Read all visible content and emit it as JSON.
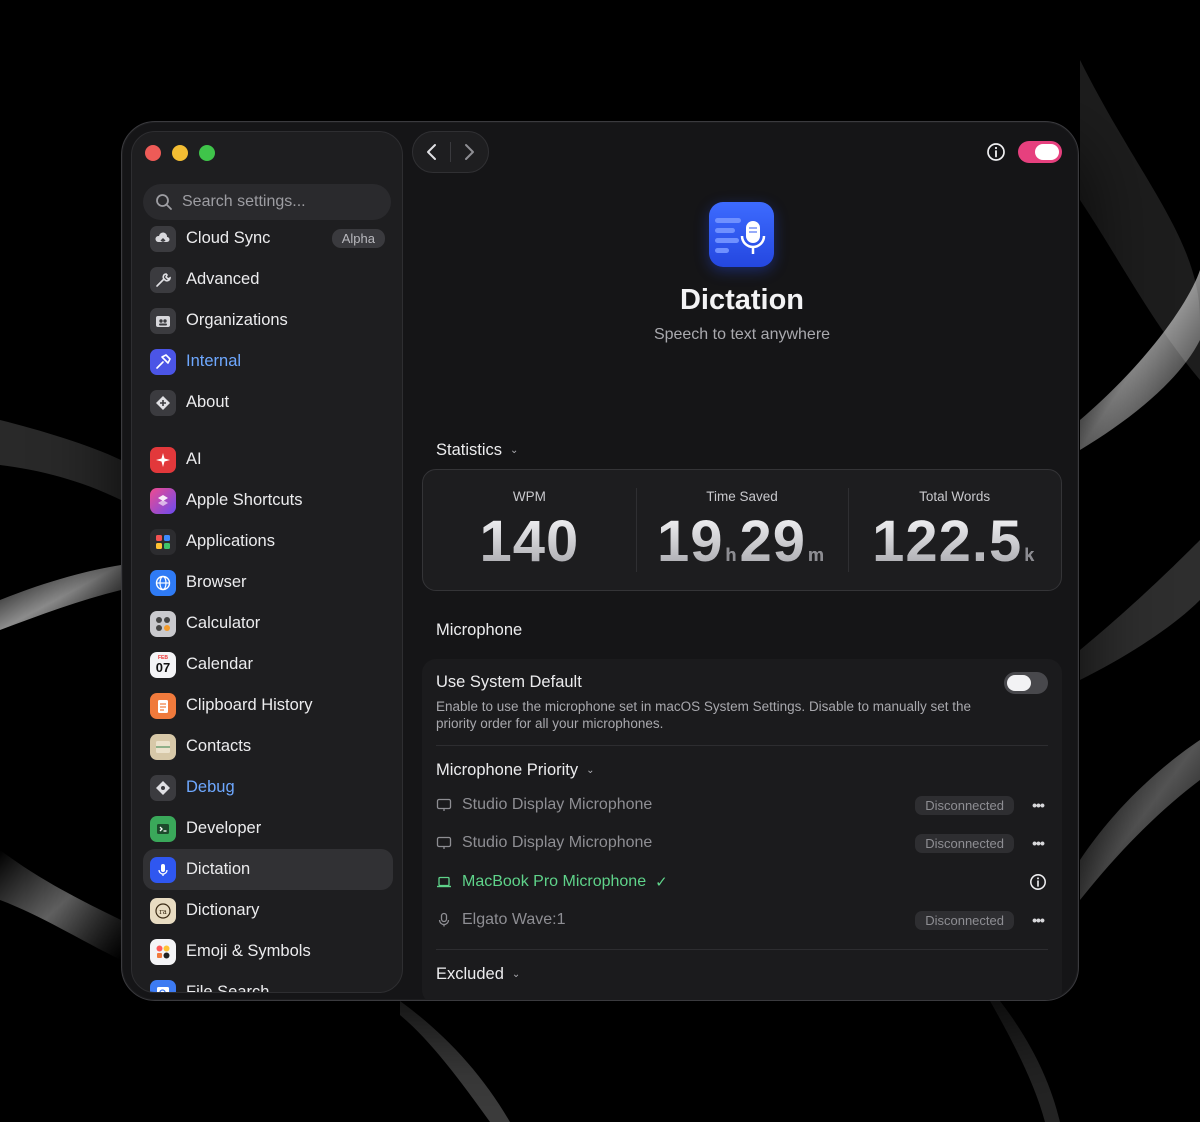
{
  "sidebar": {
    "search_placeholder": "Search settings...",
    "items_top": [
      {
        "label": "Cloud Sync",
        "icon": "cloud-sync-icon",
        "badge": "Alpha"
      },
      {
        "label": "Advanced",
        "icon": "wrench-icon"
      },
      {
        "label": "Organizations",
        "icon": "organizations-icon"
      },
      {
        "label": "Internal",
        "icon": "hammer-icon",
        "highlight": true
      },
      {
        "label": "About",
        "icon": "about-icon"
      }
    ],
    "items_ext": [
      {
        "label": "AI",
        "icon": "sparkle-icon"
      },
      {
        "label": "Apple Shortcuts",
        "icon": "shortcuts-icon"
      },
      {
        "label": "Applications",
        "icon": "applications-icon"
      },
      {
        "label": "Browser",
        "icon": "globe-icon"
      },
      {
        "label": "Calculator",
        "icon": "calculator-icon"
      },
      {
        "label": "Calendar",
        "icon": "calendar-icon",
        "month": "FEB",
        "day": "07"
      },
      {
        "label": "Clipboard History",
        "icon": "clipboard-icon"
      },
      {
        "label": "Contacts",
        "icon": "contacts-icon"
      },
      {
        "label": "Debug",
        "icon": "debug-icon",
        "highlight": true
      },
      {
        "label": "Developer",
        "icon": "developer-icon"
      },
      {
        "label": "Dictation",
        "icon": "microphone-icon",
        "active": true
      },
      {
        "label": "Dictionary",
        "icon": "dictionary-icon"
      },
      {
        "label": "Emoji & Symbols",
        "icon": "emoji-icon"
      },
      {
        "label": "File Search",
        "icon": "file-search-icon"
      }
    ]
  },
  "header": {
    "title": "Dictation",
    "subtitle": "Speech to text anywhere",
    "enabled": true
  },
  "statistics": {
    "label": "Statistics",
    "wpm": {
      "title": "WPM",
      "value": "140"
    },
    "time_saved": {
      "title": "Time Saved",
      "hours": "19",
      "hours_unit": "h",
      "minutes": "29",
      "minutes_unit": "m"
    },
    "total_words": {
      "title": "Total Words",
      "value": "122.5",
      "unit": "k"
    }
  },
  "microphone": {
    "label": "Microphone",
    "use_system_default": {
      "title": "Use System Default",
      "description": "Enable to use the microphone set in macOS System Settings. Disable to manually set the priority order for all your microphones.",
      "enabled": false
    },
    "priority_label": "Microphone Priority",
    "devices": [
      {
        "name": "Studio Display Microphone",
        "status": "Disconnected",
        "icon": "display-icon"
      },
      {
        "name": "Studio Display Microphone",
        "status": "Disconnected",
        "icon": "display-icon"
      },
      {
        "name": "MacBook Pro Microphone",
        "status": "",
        "active": true,
        "icon": "laptop-icon"
      },
      {
        "name": "Elgato Wave:1",
        "status": "Disconnected",
        "icon": "microphone-icon"
      }
    ],
    "excluded_label": "Excluded"
  },
  "colors": {
    "accent_pink": "#e6407e",
    "active_green": "#5fd38a",
    "link_blue": "#6ea8ff",
    "dictation_blue": "#2f57f0"
  }
}
